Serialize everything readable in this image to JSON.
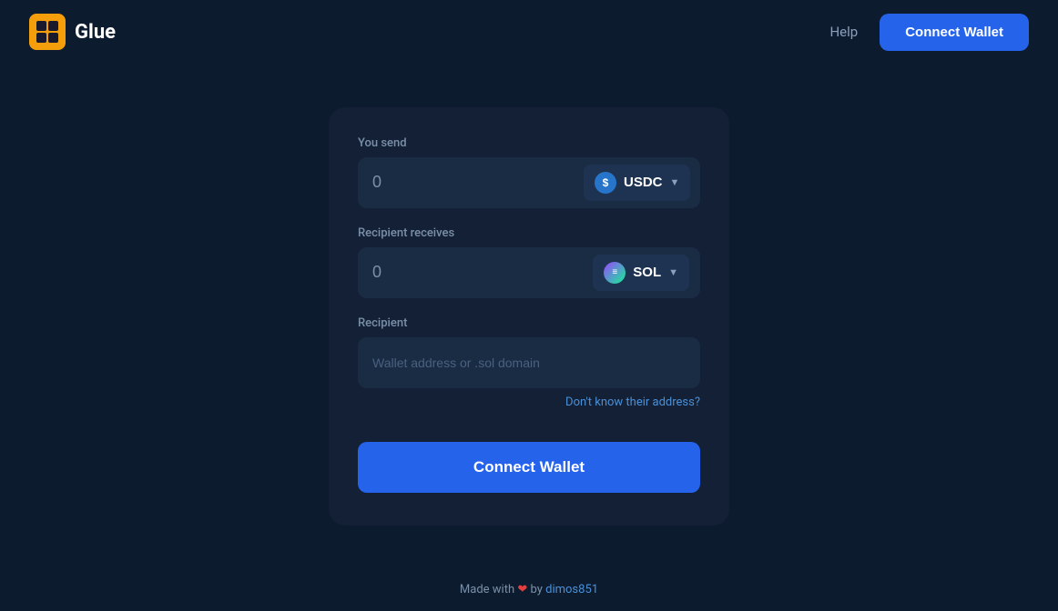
{
  "header": {
    "logo_text": "Glue",
    "help_label": "Help",
    "connect_wallet_label": "Connect Wallet"
  },
  "card": {
    "you_send_label": "You send",
    "you_send_amount": "0",
    "usdc_token": "USDC",
    "recipient_receives_label": "Recipient receives",
    "recipient_receives_amount": "0",
    "sol_token": "SOL",
    "recipient_label": "Recipient",
    "recipient_placeholder": "Wallet address or .sol domain",
    "dont_know_label": "Don't know their address?",
    "connect_wallet_btn_label": "Connect Wallet"
  },
  "footer": {
    "made_with": "Made with",
    "by": "by",
    "author": "dimos851"
  }
}
